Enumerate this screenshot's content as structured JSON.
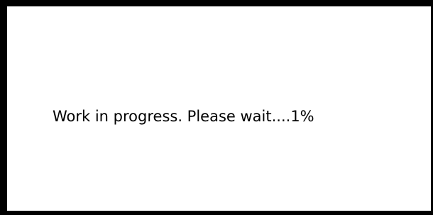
{
  "dialog": {
    "message": "Work in progress. Please wait....1%",
    "progress_percent": 1
  },
  "colors": {
    "border": "#000000",
    "background": "#ffffff",
    "text": "#000000"
  }
}
